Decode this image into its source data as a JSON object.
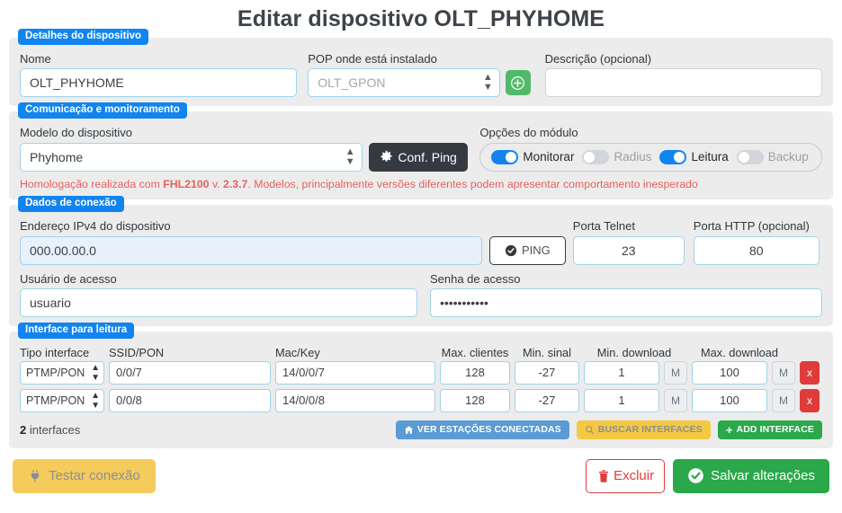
{
  "header": {
    "title": "Editar dispositivo OLT_PHYHOME"
  },
  "device_details": {
    "legend": "Detalhes do dispositivo",
    "name_label": "Nome",
    "name_value": "OLT_PHYHOME",
    "pop_label": "POP onde está instalado",
    "pop_value": "OLT_GPON",
    "add_pop_icon": "plus-icon",
    "description_label": "Descrição (opcional)",
    "description_value": "",
    "description_placeholder": ""
  },
  "communication": {
    "legend": "Comunicação e monitoramento",
    "model_label": "Modelo do dispositivo",
    "model_value": "Phyhome",
    "conf_ping_label": "Conf. Ping",
    "conf_ping_icon": "gear-icon",
    "module_options_label": "Opções do módulo",
    "toggles": [
      {
        "label": "Monitorar",
        "on": true
      },
      {
        "label": "Radius",
        "on": false
      },
      {
        "label": "Leitura",
        "on": true
      },
      {
        "label": "Backup",
        "on": false
      }
    ],
    "warning_prefix": "Homologação realizada com ",
    "warning_model": "FHL2100",
    "warning_mid": " v. ",
    "warning_version": "2.3.7",
    "warning_suffix": ". Modelos, principalmente versões diferentes podem apresentar comportamento inesperado"
  },
  "connection": {
    "legend": "Dados de conexão",
    "ip_label": "Endereço IPv4 do dispositivo",
    "ip_value": "000.00.00.0",
    "ping_label": "PING",
    "ping_icon": "check-circle-icon",
    "telnet_label": "Porta Telnet",
    "telnet_value": "23",
    "http_label": "Porta HTTP (opcional)",
    "http_value": "80",
    "user_label": "Usuário de acesso",
    "user_value": "usuario",
    "password_label": "Senha de acesso",
    "password_value": "•••••••••••"
  },
  "interfaces": {
    "legend": "Interface para leitura",
    "columns": [
      "Tipo interface",
      "SSID/PON",
      "Mac/Key",
      "Max. clientes",
      "Min. sinal",
      "Min. download",
      "Max. download"
    ],
    "rows": [
      {
        "type": "PTMP/PON",
        "ssid": "0/0/7",
        "mac": "14/0/0/7",
        "max_clients": "128",
        "min_signal": "-27",
        "min_download": "1",
        "min_unit": "M",
        "max_download": "100",
        "max_unit": "M",
        "delete_label": "x"
      },
      {
        "type": "PTMP/PON",
        "ssid": "0/0/8",
        "mac": "14/0/0/8",
        "max_clients": "128",
        "min_signal": "-27",
        "min_download": "1",
        "min_unit": "M",
        "max_download": "100",
        "max_unit": "M",
        "delete_label": "x"
      }
    ],
    "count_number": "2",
    "count_label": " interfaces",
    "view_stations_label": "VER ESTAÇÕES CONECTADAS",
    "view_stations_icon": "home-icon",
    "search_interfaces_label": "BUSCAR INTERFACES",
    "search_interfaces_icon": "magnifier-icon",
    "add_interface_label": "ADD INTERFACE",
    "add_interface_icon": "plus-icon"
  },
  "footer": {
    "test_label": "Testar conexão",
    "test_icon": "plug-icon",
    "delete_label": "Excluir",
    "delete_icon": "trash-icon",
    "save_label": "Salvar alterações",
    "save_icon": "check-circle-icon"
  },
  "colors": {
    "legend_blue": "#1184f0",
    "accent_green": "#2aa84a",
    "danger_red": "#e03b3b",
    "warn_red": "#e8615d",
    "yellow": "#f5cb5c",
    "info_blue": "#5b9bd5",
    "panel_bg": "#ececec"
  }
}
